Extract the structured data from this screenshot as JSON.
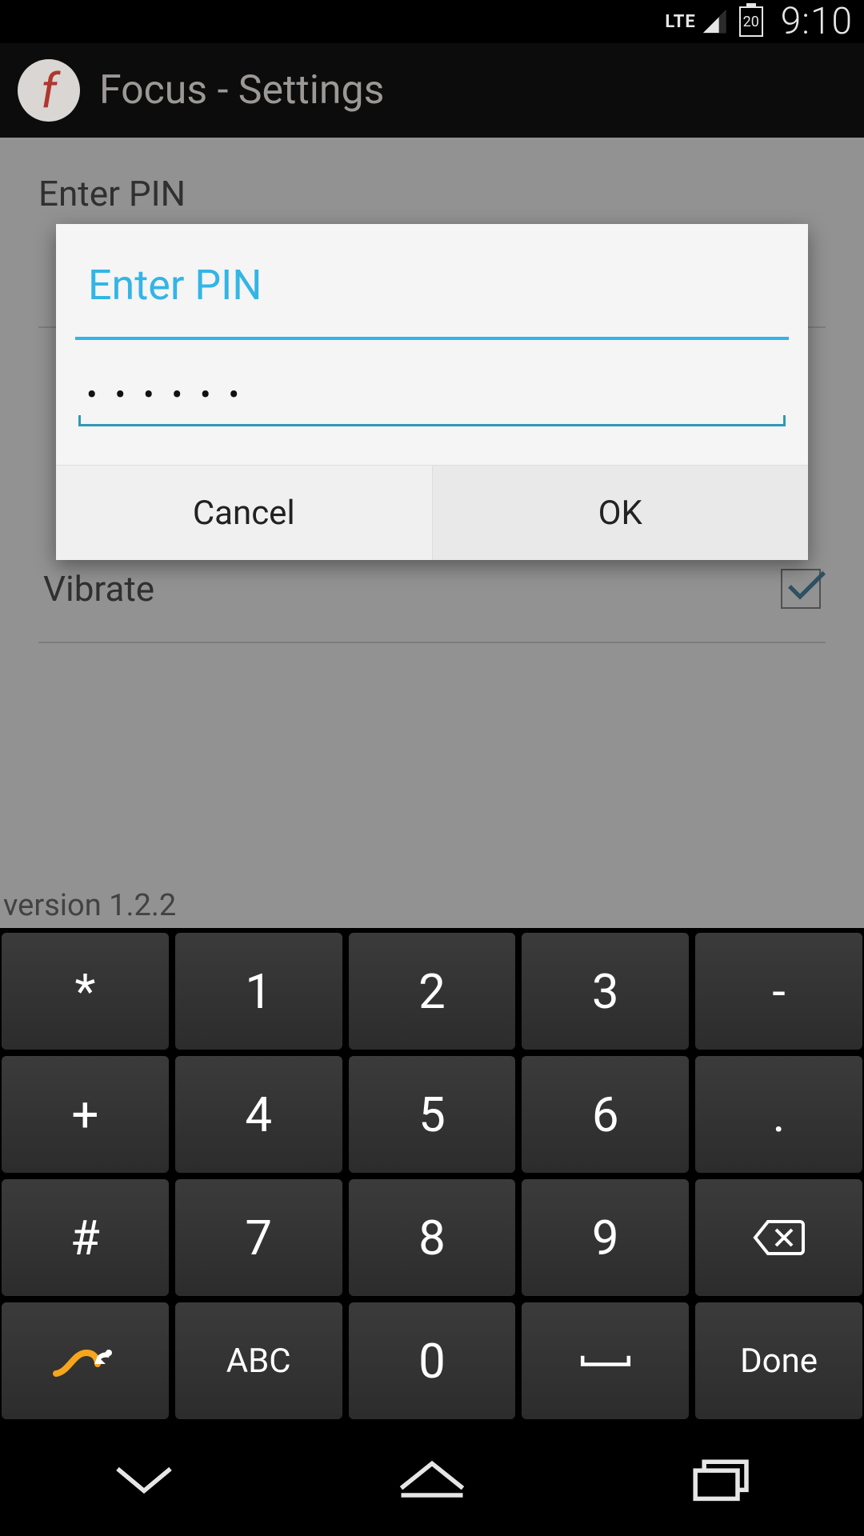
{
  "status": {
    "net_label": "LTE",
    "battery_text": "20",
    "time": "9:10"
  },
  "actionbar": {
    "icon_letter": "f",
    "title": "Focus - Settings"
  },
  "background": {
    "enter_pin_label": "Enter PIN",
    "vibrate_label": "Vibrate",
    "version": "version 1.2.2"
  },
  "dialog": {
    "title": "Enter PIN",
    "pin_value": "••••••",
    "cancel": "Cancel",
    "ok": "OK"
  },
  "keyboard": {
    "rows": [
      [
        "*",
        "1",
        "2",
        "3",
        "-"
      ],
      [
        "+",
        "4",
        "5",
        "6",
        "."
      ],
      [
        "#",
        "7",
        "8",
        "9",
        "__backspace"
      ],
      [
        "__swype",
        "ABC",
        "0",
        "__space",
        "Done"
      ]
    ]
  }
}
